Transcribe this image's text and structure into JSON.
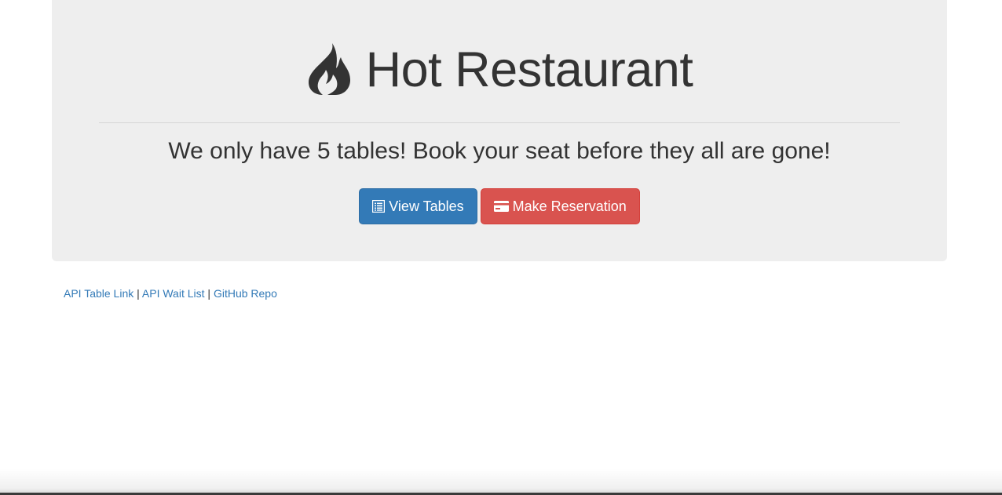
{
  "header": {
    "title": "Hot Restaurant",
    "title_icon": "fire-icon",
    "subtitle": "We only have 5 tables! Book your seat before they all are gone!"
  },
  "actions": {
    "view_tables": {
      "label": "View Tables",
      "icon": "list-alt-icon",
      "color": "#337ab7"
    },
    "make_reservation": {
      "label": "Make Reservation",
      "icon": "credit-card-icon",
      "color": "#d9534f"
    }
  },
  "footer": {
    "links": [
      {
        "label": "API Table Link"
      },
      {
        "label": "API Wait List"
      },
      {
        "label": "GitHub Repo"
      }
    ],
    "separator": "|"
  },
  "colors": {
    "jumbotron_bg": "#eeeeee",
    "link": "#337ab7",
    "text": "#333333"
  }
}
